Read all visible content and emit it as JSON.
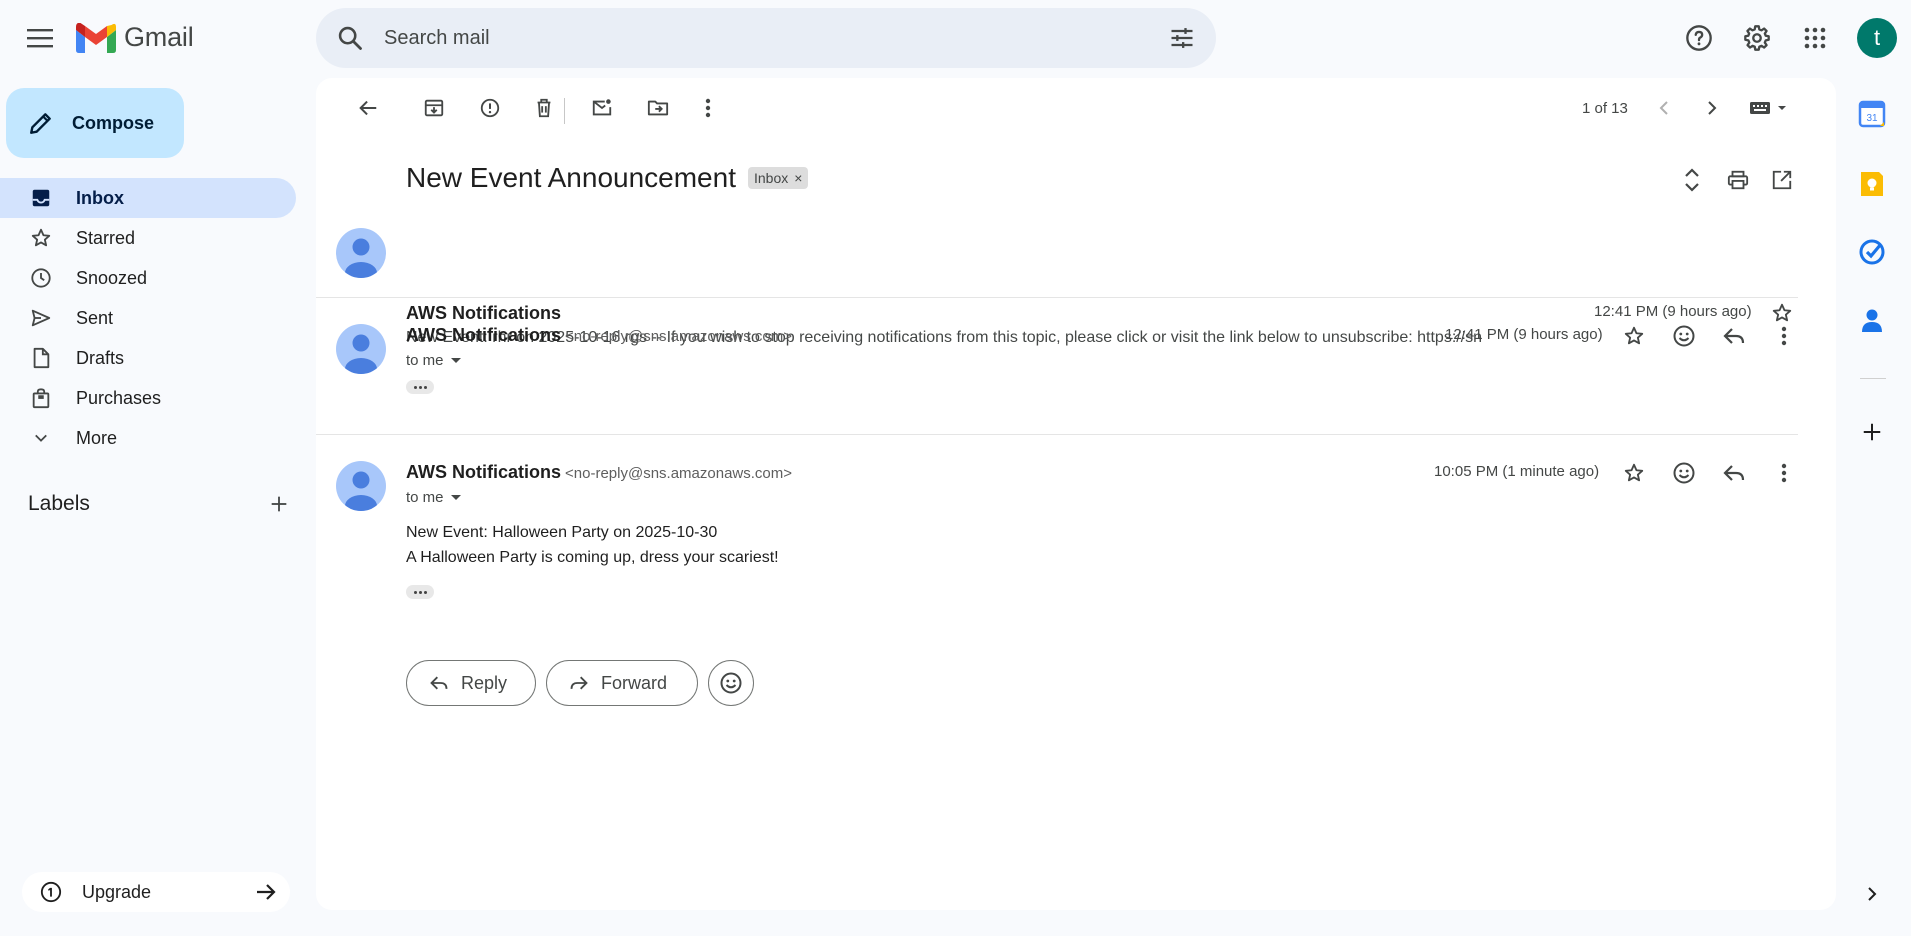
{
  "app": {
    "name": "Gmail"
  },
  "search": {
    "placeholder": "Search mail"
  },
  "user": {
    "initial": "t"
  },
  "sidebar": {
    "compose_label": "Compose",
    "items": [
      {
        "label": "Inbox",
        "icon": "inbox-icon",
        "active": true
      },
      {
        "label": "Starred",
        "icon": "star-icon"
      },
      {
        "label": "Snoozed",
        "icon": "clock-icon"
      },
      {
        "label": "Sent",
        "icon": "send-icon"
      },
      {
        "label": "Drafts",
        "icon": "draft-icon"
      },
      {
        "label": "Purchases",
        "icon": "shopping-bag-icon"
      },
      {
        "label": "More",
        "icon": "chevron-down-icon"
      }
    ],
    "labels_title": "Labels",
    "upgrade_label": "Upgrade"
  },
  "toolbar": {
    "pager": "1 of 13"
  },
  "thread": {
    "subject": "New Event Announcement",
    "label_chip": "Inbox",
    "messages": [
      {
        "sender": "AWS Notifications",
        "time": "12:41 PM (9 hours ago)",
        "snippet": "New Event: rhr on 2025-10-16 rgs -- If you wish to stop receiving notifications from this topic, please click or visit the link below to unsubscribe: https://sn"
      },
      {
        "sender": "AWS Notifications",
        "email": "<no-reply@sns.amazonaws.com>",
        "time": "12:41 PM (9 hours ago)",
        "to": "to me"
      },
      {
        "sender": "AWS Notifications",
        "email": "<no-reply@sns.amazonaws.com>",
        "time": "10:05 PM (1 minute ago)",
        "to": "to me",
        "body": [
          "New Event: Halloween Party on 2025-10-30",
          "A Halloween Party is coming up, dress your scariest!"
        ]
      }
    ],
    "reply_label": "Reply",
    "forward_label": "Forward"
  },
  "side_panel": {
    "calendar_day": "31"
  },
  "colors": {
    "background": "#f8fafd",
    "compose": "#c2e7ff",
    "active_nav": "#d3e3fd",
    "avatar": "#00796b",
    "search": "#e9eef6"
  }
}
